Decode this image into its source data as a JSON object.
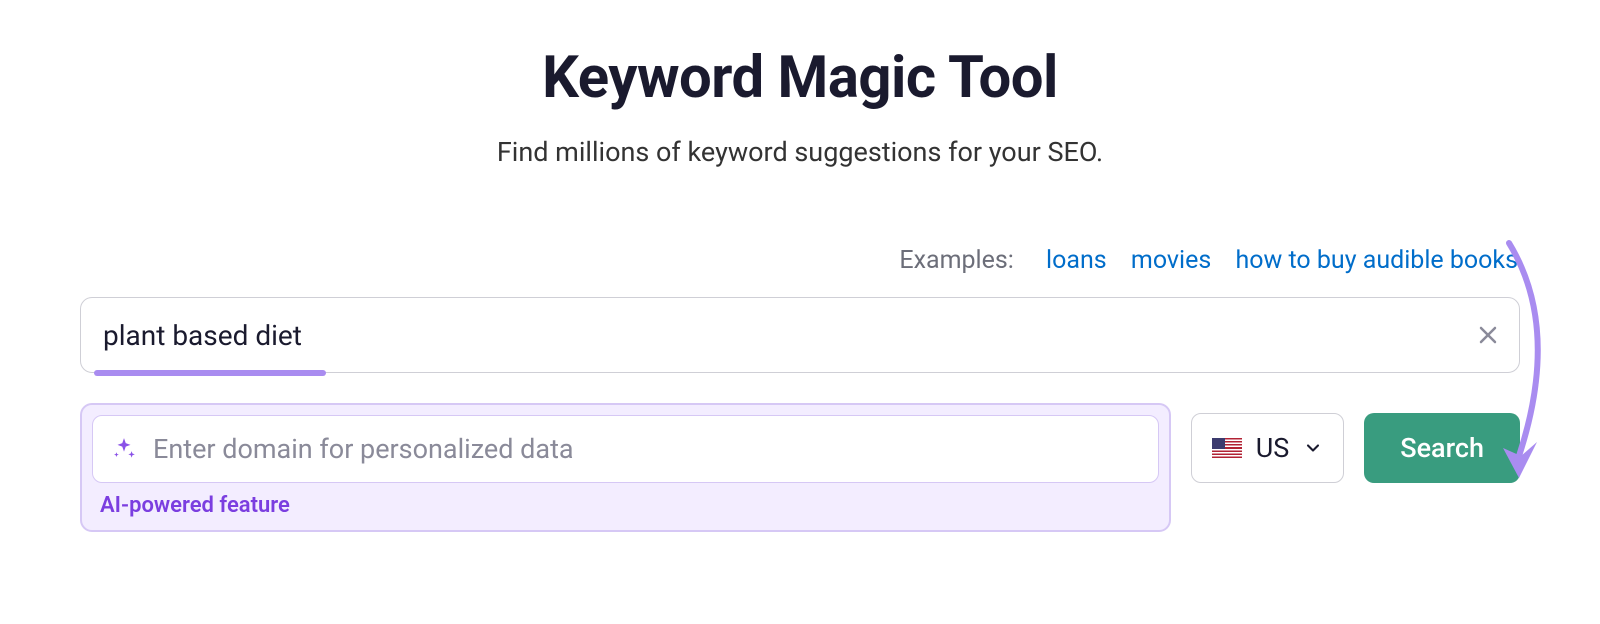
{
  "title": "Keyword Magic Tool",
  "subtitle": "Find millions of keyword suggestions for your SEO.",
  "examples": {
    "label": "Examples:",
    "items": [
      "loans",
      "movies",
      "how to buy audible books"
    ]
  },
  "keyword_input": {
    "value": "plant based diet"
  },
  "domain_input": {
    "placeholder": "Enter domain for personalized data",
    "ai_label": "AI-powered feature"
  },
  "country": {
    "code": "US"
  },
  "search_button": "Search"
}
